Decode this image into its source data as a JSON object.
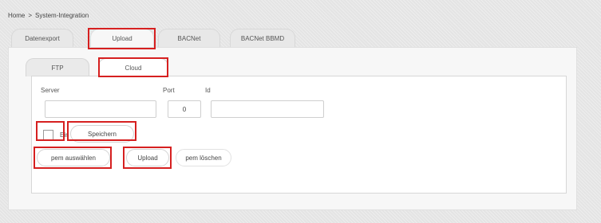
{
  "breadcrumb": {
    "home": "Home",
    "separator": ">",
    "current": "System-Integration"
  },
  "outer_tabs": [
    "Datenexport",
    "Upload",
    "BACNet",
    "BACNet BBMD"
  ],
  "inner_tabs": [
    "FTP",
    "Cloud"
  ],
  "form": {
    "server_label": "Server",
    "port_label": "Port",
    "id_label": "Id",
    "server_value": "",
    "port_value": "0",
    "id_value": ""
  },
  "options": {
    "ein_label": "Ein",
    "ein_checked": false
  },
  "buttons": {
    "speichern": "Speichern",
    "pem_auswaehlen": "pem auswählen",
    "upload": "Upload",
    "pem_loeschen": "pem löschen"
  },
  "highlight_color": "#d62020"
}
